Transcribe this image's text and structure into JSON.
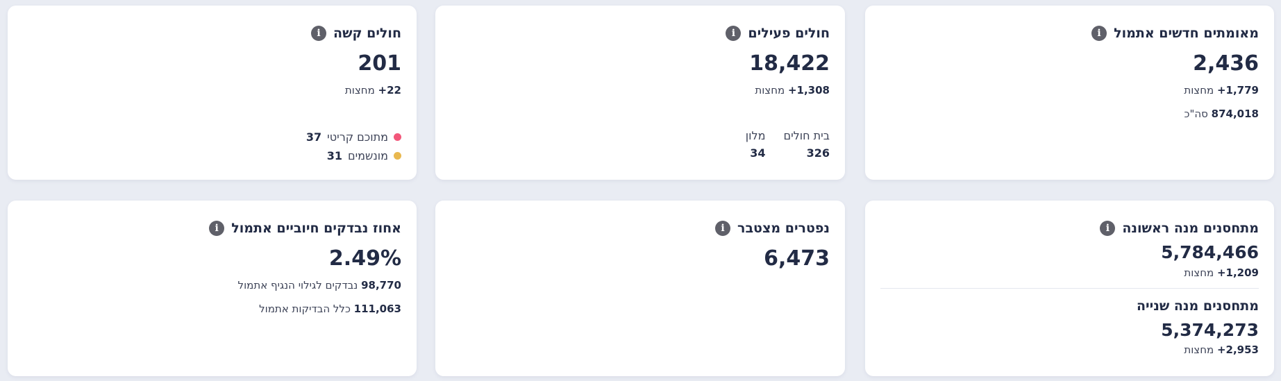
{
  "cards": {
    "new_confirmed": {
      "title": "מאומתים חדשים אתמול",
      "value": "2,436",
      "after_midnight_value": "1,779+",
      "after_midnight_label": "מחצות",
      "total_value": "874,018",
      "total_label": "סה\"כ"
    },
    "active": {
      "title": "חולים פעילים",
      "value": "18,422",
      "after_midnight_value": "1,308+",
      "after_midnight_label": "מחצות",
      "hospital_label": "בית חולים",
      "hospital_value": "326",
      "hotel_label": "מלון",
      "hotel_value": "34"
    },
    "severe": {
      "title": "חולים קשה",
      "value": "201",
      "after_midnight_value": "22+",
      "after_midnight_label": "מחצות",
      "critical_label": "מתוכם קריטי",
      "critical_value": "37",
      "ventilated_label": "מונשמים",
      "ventilated_value": "31",
      "critical_color": "#f2577a",
      "ventilated_color": "#e9b84f"
    },
    "vaccinated": {
      "first_title": "מתחסנים מנה ראשונה",
      "first_value": "5,784,466",
      "first_after_value": "1,209+",
      "first_after_label": "מחצות",
      "second_title": "מתחסנים מנה שנייה",
      "second_value": "5,374,273",
      "second_after_value": "2,953+",
      "second_after_label": "מחצות"
    },
    "deceased": {
      "title": "נפטרים מצטבר",
      "value": "6,473"
    },
    "positive_rate": {
      "title": "אחוז נבדקים חיוביים אתמול",
      "value": "2.49%",
      "tested_value": "98,770",
      "tested_label": "נבדקים לגילוי הנגיף אתמול",
      "all_tests_value": "111,063",
      "all_tests_label": "כלל הבדיקות אתמול"
    }
  },
  "icons": {
    "info": "i"
  },
  "colors": {
    "background": "#e9ecf3",
    "card": "#ffffff",
    "text": "#222b45",
    "info_icon": "#5f6069"
  }
}
